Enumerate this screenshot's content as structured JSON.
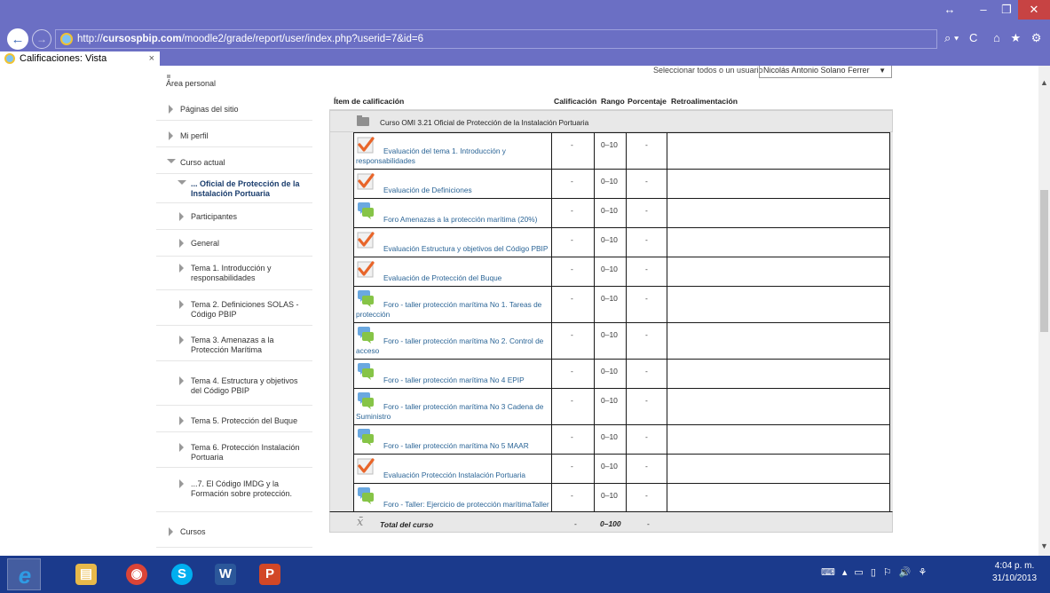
{
  "browser": {
    "url_prefix": "http://",
    "url_domain": "cursospbip.com",
    "url_path": "/moodle2/grade/report/user/index.php?userid=7&id=6",
    "tab_title": "Calificaciones: Vista",
    "tab_close": "×",
    "back_glyph": "←",
    "forward_glyph": "→",
    "search_glyph": "⌕ ▾",
    "refresh_glyph": "C",
    "home_glyph": "⌂",
    "fav_glyph": "★",
    "tools_glyph": "⚙",
    "resize_glyph": "↔",
    "minimize_glyph": "–",
    "maximize_glyph": "❐",
    "close_glyph": "✕"
  },
  "page": {
    "user_select_label": "Seleccionar todos o un usuario",
    "user_select_value": "Nicolás Antonio Solano Ferrer"
  },
  "sidebar": {
    "items": [
      {
        "label": "Área personal",
        "icon": "bullet-icon"
      },
      {
        "label": "Páginas del sitio",
        "icon": "chevron-right-icon"
      },
      {
        "label": "Mi perfil",
        "icon": "chevron-right-icon"
      },
      {
        "label": "Curso actual",
        "icon": "chevron-down-icon"
      },
      {
        "label": "... Oficial de Protección de la Instalación Portuaria",
        "icon": "chevron-down-icon"
      },
      {
        "label": "Participantes",
        "icon": "chevron-right-icon"
      },
      {
        "label": "General",
        "icon": "chevron-right-icon"
      },
      {
        "label": "Tema 1. Introducción y responsabilidades",
        "icon": "chevron-right-icon"
      },
      {
        "label": "Tema 2. Definiciones SOLAS - Código PBIP",
        "icon": "chevron-right-icon"
      },
      {
        "label": "Tema 3. Amenazas a la Protección Marítima",
        "icon": "chevron-right-icon"
      },
      {
        "label": "Tema 4. Estructura y objetivos del Código PBIP",
        "icon": "chevron-right-icon"
      },
      {
        "label": "Tema 5. Protección del Buque",
        "icon": "chevron-right-icon"
      },
      {
        "label": "Tema 6. Protección Instalación Portuaria",
        "icon": "chevron-right-icon"
      },
      {
        "label": "...7. El Código IMDG y la Formación sobre protección.",
        "icon": "chevron-right-icon"
      },
      {
        "label": "Cursos",
        "icon": "chevron-right-icon"
      }
    ]
  },
  "grade_table": {
    "headers": {
      "item": "Ítem de calificación",
      "calificacion": "Calificación",
      "rango": "Rango",
      "porcentaje": "Porcentaje",
      "retroalimentacion": "Retroalimentación"
    },
    "category": "Curso OMI 3.21 Oficial de Protección de la Instalación Portuaria",
    "rows": [
      {
        "name": "Evaluación del tema 1. Introducción y responsabilidades",
        "icon": "quiz-check-icon",
        "grade": "-",
        "range": "0–10",
        "pct": "-"
      },
      {
        "name": "Evaluación de Definiciones",
        "icon": "quiz-check-icon",
        "grade": "-",
        "range": "0–10",
        "pct": "-"
      },
      {
        "name": "Foro Amenazas a la protección marítima (20%)",
        "icon": "forum-icon",
        "grade": "-",
        "range": "0–10",
        "pct": "-"
      },
      {
        "name": "Evaluación Estructura y objetivos del Código PBIP",
        "icon": "quiz-check-icon",
        "grade": "-",
        "range": "0–10",
        "pct": "-"
      },
      {
        "name": "Evaluación de Protección del Buque",
        "icon": "quiz-check-icon",
        "grade": "-",
        "range": "0–10",
        "pct": "-"
      },
      {
        "name": "Foro - taller protección marítima No 1. Tareas de protección",
        "icon": "forum-icon",
        "grade": "-",
        "range": "0–10",
        "pct": "-"
      },
      {
        "name": "Foro - taller protección marítima No 2. Control de acceso",
        "icon": "forum-icon",
        "grade": "-",
        "range": "0–10",
        "pct": "-"
      },
      {
        "name": "Foro - taller protección marítima No 4 EPIP",
        "icon": "forum-icon",
        "grade": "-",
        "range": "0–10",
        "pct": "-"
      },
      {
        "name": "Foro - taller protección marítima No 3 Cadena de Suministro",
        "icon": "forum-icon",
        "grade": "-",
        "range": "0–10",
        "pct": "-"
      },
      {
        "name": "Foro - taller protección marítima No 5 MAAR",
        "icon": "forum-icon",
        "grade": "-",
        "range": "0–10",
        "pct": "-"
      },
      {
        "name": "Evaluación Protección Instalación Portuaria",
        "icon": "quiz-check-icon",
        "grade": "-",
        "range": "0–10",
        "pct": "-"
      },
      {
        "name": "Foro - Taller: Ejercicio de protección marítimaTaller",
        "icon": "forum-icon",
        "grade": "-",
        "range": "0–10",
        "pct": "-"
      }
    ],
    "total": {
      "symbol": "x̄",
      "label": "Total del curso",
      "grade": "-",
      "range": "0–100",
      "pct": "-"
    }
  },
  "taskbar": {
    "apps": [
      {
        "name": "internet-explorer",
        "glyph": "e",
        "color": "#2f9be4"
      },
      {
        "name": "file-explorer",
        "glyph": "▤",
        "color": "#e8b94a"
      },
      {
        "name": "chrome",
        "glyph": "◉",
        "color": "#db4437"
      },
      {
        "name": "skype",
        "glyph": "S",
        "color": "#00aff0"
      },
      {
        "name": "word",
        "glyph": "W",
        "color": "#2b579a"
      },
      {
        "name": "powerpoint",
        "glyph": "P",
        "color": "#d24726"
      }
    ],
    "tray_glyphs": [
      "⌨",
      "▴",
      "▭",
      "▯",
      "⚐",
      "🔊",
      "⚘"
    ],
    "time": "4:04 p. m.",
    "date": "31/10/2013"
  },
  "colors": {
    "chrome_purple": "#6b6fc4",
    "taskbar_blue": "#1b3a8c",
    "link_blue": "#2a6496",
    "check_orange": "#e8652a"
  }
}
